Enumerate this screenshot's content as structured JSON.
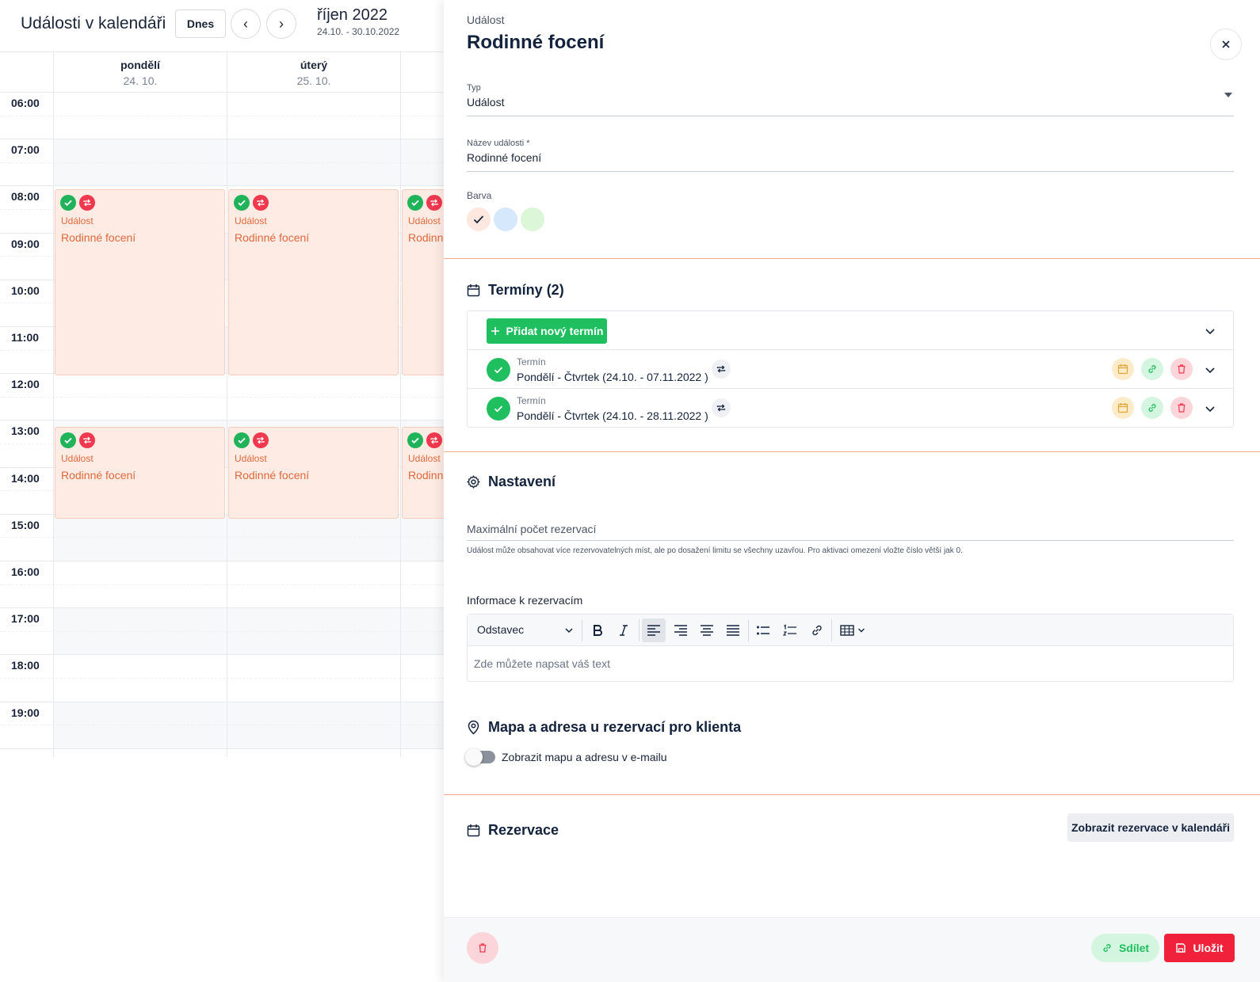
{
  "calendar": {
    "title": "Události v kalendáři",
    "today_label": "Dnes",
    "prev_label": "‹",
    "next_label": "›",
    "month": "říjen 2022",
    "range": "24.10. - 30.10.2022",
    "days": [
      {
        "name": "pondělí",
        "date": "24. 10."
      },
      {
        "name": "úterý",
        "date": "25. 10."
      }
    ],
    "hours": [
      "06:00",
      "07:00",
      "08:00",
      "09:00",
      "10:00",
      "11:00",
      "12:00",
      "13:00",
      "14:00",
      "15:00",
      "16:00",
      "17:00",
      "18:00",
      "19:00"
    ],
    "events": [
      {
        "type": "Událost",
        "name": "Rodinné focení"
      },
      {
        "type": "Událost",
        "name": "Rodinné focení"
      },
      {
        "type": "Událost",
        "name": "Rodinné focení"
      },
      {
        "type": "Událost",
        "name": "Rodinné focení"
      },
      {
        "type": "Událost",
        "name": "Rodinné focení"
      },
      {
        "type": "Událost",
        "name": "Rodinné focení"
      }
    ]
  },
  "panel": {
    "kicker": "Událost",
    "title": "Rodinné focení",
    "type_label": "Typ",
    "type_value": "Událost",
    "name_label": "Název události *",
    "name_value": "Rodinné focení",
    "color_label": "Barva",
    "colors": [
      "#fde7df",
      "#d6e8fb",
      "#dcf7d8"
    ],
    "terms": {
      "title": "Termíny (2)",
      "add_label": "Přidat nový termín",
      "items": [
        {
          "label": "Termín",
          "value": "Pondělí - Čtvrtek (24.10. - 07.11.2022 )"
        },
        {
          "label": "Termín",
          "value": "Pondělí - Čtvrtek (24.10. - 28.11.2022 )"
        }
      ]
    },
    "settings": {
      "title": "Nastavení",
      "max_label": "Maximální počet rezervací",
      "helper": "Událost může obsahovat více rezervovatelných míst, ale po dosažení limitu se všechny uzavřou. Pro aktivaci omezení vložte číslo větší jak 0."
    },
    "info": {
      "label": "Informace k rezervacím",
      "format": "Odstavec",
      "placeholder": "Zde můžete napsat váš text"
    },
    "map": {
      "title": "Mapa a adresa u rezervací pro klienta",
      "toggle_label": "Zobrazit mapu a adresu v e-mailu",
      "toggle_on": false
    },
    "reservations": {
      "title": "Rezervace",
      "show_button": "Zobrazit rezervace v kalendáři"
    },
    "footer": {
      "share": "Sdílet",
      "save": "Uložit"
    }
  },
  "colors": {
    "accent_green": "#1fbf5f",
    "accent_red": "#f0223b",
    "event_bg": "#fdebe4",
    "event_text": "#e0683a",
    "separator": "#f2a88f"
  }
}
